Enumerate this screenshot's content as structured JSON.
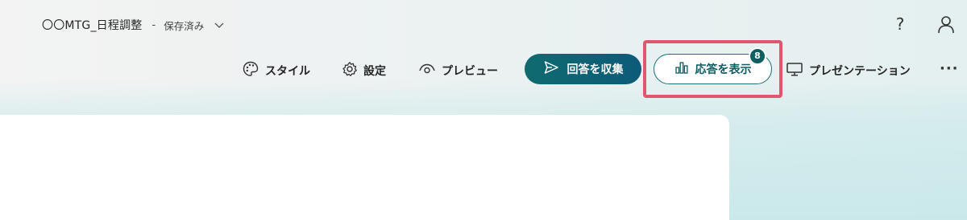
{
  "title_bar": {
    "form_title": "〇〇MTG_日程調整",
    "separator": "-",
    "save_status": "保存済み",
    "icons": [
      "chevron-down-icon",
      "help-icon",
      "user-icon"
    ]
  },
  "help": {
    "label": "?"
  },
  "command_bar": {
    "style_label": "スタイル",
    "settings_label": "設定",
    "preview_label": "プレビュー",
    "collect_label": "回答を収集",
    "view_responses_label": "応答を表示",
    "response_count": "8",
    "present_label": "プレゼンテーション",
    "more_label": "···"
  },
  "colors": {
    "collect_button": "#0f6b6f",
    "highlight_border": "#e0566e",
    "badge": "#0f5f62",
    "background_teal": "#cbe8ea"
  }
}
